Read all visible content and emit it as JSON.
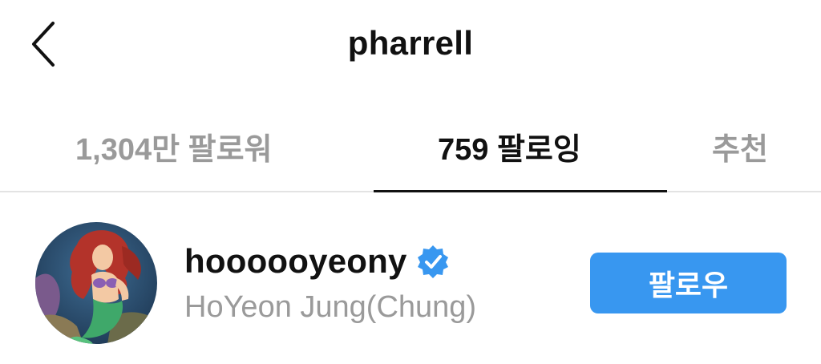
{
  "header": {
    "title": "pharrell",
    "back_icon": "chevron-left-icon"
  },
  "tabs": [
    {
      "label": "1,304만 팔로워",
      "active": false
    },
    {
      "label": "759 팔로잉",
      "active": true
    },
    {
      "label": "추천",
      "active": false
    }
  ],
  "user": {
    "username": "hoooooyeony",
    "full_name": "HoYeon Jung(Chung)",
    "verified": true,
    "verified_icon": "verified-badge-icon",
    "avatar_icon": "mermaid-avatar",
    "follow_label": "팔로우"
  },
  "colors": {
    "accent": "#3897f0",
    "muted_text": "#9a9a9a",
    "primary_text": "#111111",
    "divider": "#e3e3e3"
  }
}
